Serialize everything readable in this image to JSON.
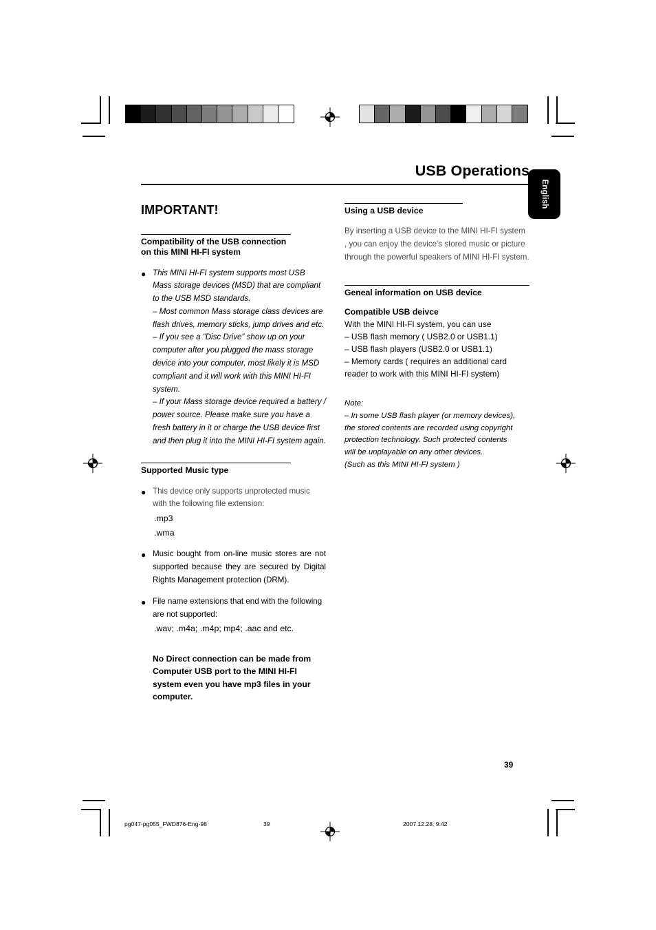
{
  "header": {
    "title": "USB Operations",
    "language_tab": "English"
  },
  "left_column": {
    "important_heading": "IMPORTANT!",
    "compat_heading": "Compatibility of the USB connection on this MINI HI-FI system",
    "compat_bullet": {
      "line1": "This MINI HI-FI system supports most USB",
      "line2": "Mass storage devices (MSD) that are compliant to the USB MSD standards.",
      "dash1": "–  Most common Mass storage class devices are flash drives, memory sticks, jump drives and etc.",
      "dash2": "–  If you see a “Disc Drive” show up on your computer after you plugged the mass storage device into your computer, most likely it is MSD compliant and it will work with this MINI HI-FI system.",
      "dash3": "–  If your Mass storage device required a battery / power source. Please make sure you have a fresh battery in it or charge the USB device first and then plug it into the MINI HI-FI system again."
    },
    "music_heading": "Supported Music type",
    "music_bullet": {
      "text": "This device only supports unprotected music with the following file extension:",
      "ext1": ".mp3",
      "ext2": ".wma"
    },
    "drm_bullet": "Music bought from on-line music stores are not supported because they are secured by Digital Rights Management protection (DRM).",
    "unsupported_bullet": {
      "text": "File name extensions that end with the following are not supported:",
      "ext_list": ".wav; .m4a; .m4p; mp4; .aac and etc."
    },
    "no_direct_note": "No Direct connection can be made from Computer USB port to the MINI HI-FI system even you have mp3 files in your computer."
  },
  "right_column": {
    "using_heading": "Using a USB device",
    "using_text": "By inserting a USB device to the MINI HI-FI system , you can enjoy the device's stored music or picture through the powerful speakers of MINI HI-FI system.",
    "general_heading": "Geneal information on USB device",
    "compatible_subheading": "Compatible  USB deivce",
    "compatible_intro": "With the MINI HI-FI system, you can use",
    "compatible_items": [
      "–  USB  flash memory ( USB2.0 or USB1.1)",
      "–  USB  flash players (USB2.0 or USB1.1)",
      "–  Memory cards ( requires an additional card reader to work with this MINI HI-FI system)"
    ],
    "note_label": "Note:",
    "note_lines": [
      "–  In some USB flash player (or memory devices),",
      "the stored contents are recorded using copyright",
      "protection technology. Such protected contents",
      "will be unplayable on any other devices.",
      "(Such as  this MINI HI-FI system )"
    ]
  },
  "footer": {
    "page_number": "39",
    "file_name": "pg047-pg055_FWD876-Eng-98",
    "sheet_number": "39",
    "timestamp": "2007.12.28, 9:42"
  },
  "prepress": {
    "calibration_left": [
      "#000000",
      "#1c1c1c",
      "#333333",
      "#4d4d4d",
      "#636363",
      "#7d7d7d",
      "#949494",
      "#ababab",
      "#c9c9c9",
      "#ebebeb",
      "#ffffff"
    ],
    "calibration_right": [
      "#e2e2e2",
      "#666666",
      "#ababab",
      "#1c1c1c",
      "#949494",
      "#4d4d4d",
      "#000000",
      "#f0f0f0",
      "#ababab",
      "#d6d6d6",
      "#7d7d7d"
    ]
  }
}
